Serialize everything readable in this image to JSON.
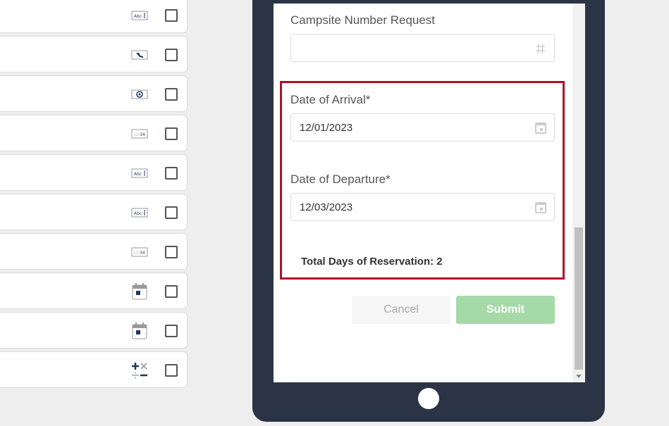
{
  "field_list": {
    "rows": [
      {
        "icon": "text-field-icon"
      },
      {
        "icon": "phone-field-icon"
      },
      {
        "icon": "email-field-icon"
      },
      {
        "icon": "number-field-icon"
      },
      {
        "icon": "text-field-icon"
      },
      {
        "icon": "text-field-icon"
      },
      {
        "icon": "number-field-icon"
      },
      {
        "icon": "calendar-icon"
      },
      {
        "icon": "calendar-icon"
      },
      {
        "icon": "calculation-icon"
      }
    ]
  },
  "form": {
    "campsite_label": "Campsite Number Request",
    "campsite_value": "",
    "arrival_label": "Date of Arrival*",
    "arrival_value": "12/01/2023",
    "departure_label": "Date of Departure*",
    "departure_value": "12/03/2023",
    "total_text": "Total Days of Reservation: 2",
    "cancel_label": "Cancel",
    "submit_label": "Submit"
  },
  "colors": {
    "highlight": "#b0102a",
    "tablet_frame": "#2b3445",
    "submit": "#a6d9a8",
    "icon_navy": "#1f3a5f"
  }
}
